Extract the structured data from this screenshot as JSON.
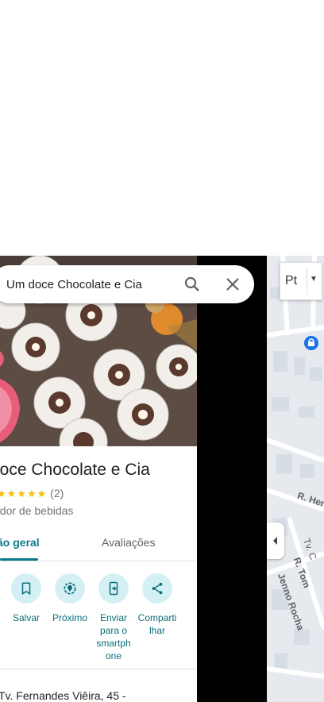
{
  "search": {
    "value": "Um doce Chocolate e Cia"
  },
  "place": {
    "title": "doce Chocolate e Cia",
    "stars": "★★★★★",
    "review_count": "(2)",
    "category": "edor de bebidas",
    "address": "Tv. Fernandes Viêira, 45 -"
  },
  "tabs": [
    {
      "label": "ão geral"
    },
    {
      "label": "Avaliações"
    }
  ],
  "actions": [
    {
      "label": "Salvar",
      "icon": "bookmark-icon"
    },
    {
      "label": "Próximo",
      "icon": "nearby-icon"
    },
    {
      "label": "Enviar para o smartph one",
      "icon": "send-to-phone-icon"
    },
    {
      "label": "Compartilhar",
      "icon": "share-icon"
    }
  ],
  "map": {
    "layer_label": "Pt",
    "streets": [
      "R. Her",
      "R. Tom",
      "Jenno Rocha",
      "Tv. C"
    ]
  },
  "colors": {
    "accent": "#0b7a8b",
    "action_bg": "#d4f0f5",
    "star": "#fbbc04"
  }
}
